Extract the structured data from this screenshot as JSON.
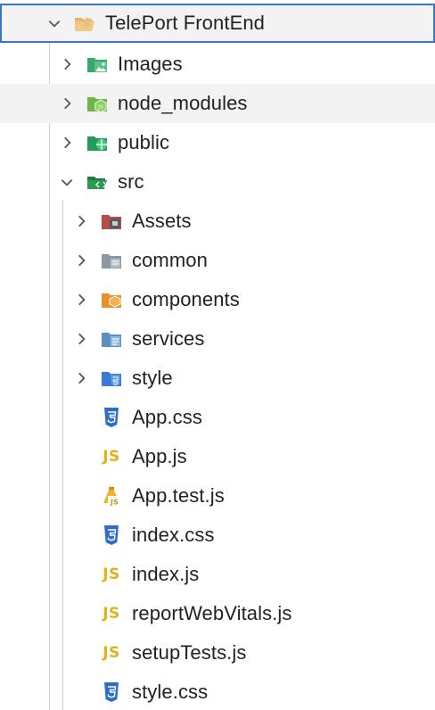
{
  "explorer": {
    "root": {
      "label": "TelePort FrontEnd",
      "icon": "folder-open-icon",
      "expanded": true
    },
    "top_items": [
      {
        "label": "Images",
        "icon": "images-folder-icon",
        "expanded": false
      },
      {
        "label": "node_modules",
        "icon": "node-modules-folder-icon",
        "expanded": false
      },
      {
        "label": "public",
        "icon": "public-folder-icon",
        "expanded": false
      },
      {
        "label": "src",
        "icon": "src-folder-icon",
        "expanded": true
      }
    ],
    "src_items": [
      {
        "label": "Assets",
        "icon": "assets-folder-icon",
        "kind": "folder"
      },
      {
        "label": "common",
        "icon": "common-folder-icon",
        "kind": "folder"
      },
      {
        "label": "components",
        "icon": "components-folder-icon",
        "kind": "folder"
      },
      {
        "label": "services",
        "icon": "services-folder-icon",
        "kind": "folder"
      },
      {
        "label": "style",
        "icon": "style-folder-icon",
        "kind": "folder"
      },
      {
        "label": "App.css",
        "icon": "css-file-icon",
        "kind": "file"
      },
      {
        "label": "App.js",
        "icon": "js-file-icon",
        "kind": "file"
      },
      {
        "label": "App.test.js",
        "icon": "test-js-file-icon",
        "kind": "file"
      },
      {
        "label": "index.css",
        "icon": "css-file-icon",
        "kind": "file"
      },
      {
        "label": "index.js",
        "icon": "js-file-icon",
        "kind": "file"
      },
      {
        "label": "reportWebVitals.js",
        "icon": "js-file-icon",
        "kind": "file"
      },
      {
        "label": "setupTests.js",
        "icon": "js-file-icon",
        "kind": "file"
      },
      {
        "label": "style.css",
        "icon": "css-file-icon",
        "kind": "file"
      }
    ],
    "js_glyph": "JS",
    "colors": {
      "selection_border": "#3b74c9",
      "hover_background": "#f3f3f3",
      "css_icon": "#2f6dcc",
      "js_icon": "#e2b21a"
    }
  }
}
